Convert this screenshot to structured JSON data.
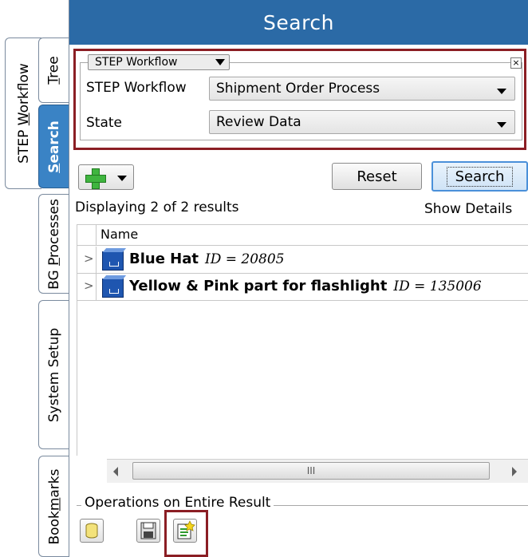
{
  "header": {
    "title": "Search"
  },
  "tabs": {
    "workflow": {
      "label_pre": "STEP ",
      "label_u": "W",
      "label_post": "orkflow"
    },
    "tree": {
      "label_pre": "",
      "label_u": "T",
      "label_post": "ree"
    },
    "search": {
      "label_pre": "",
      "label_u": "S",
      "label_post": "earch"
    },
    "bg": {
      "label_pre": "BG ",
      "label_u": "P",
      "label_post": "rocesses"
    },
    "system": {
      "label": "System Setup"
    },
    "bookmarks": {
      "label_pre": "Book",
      "label_u": "m",
      "label_post": "arks"
    }
  },
  "workflow_box": {
    "group_label": "STEP Workflow",
    "close": "×",
    "fields": [
      {
        "label": "STEP Workflow",
        "value": "Shipment Order Process"
      },
      {
        "label": "State",
        "value": "Review Data"
      }
    ]
  },
  "toolbar": {
    "reset_label": "Reset",
    "search_label": "Search"
  },
  "results": {
    "summary": "Displaying 2 of 2 results",
    "show_details": "Show Details",
    "column_name": "Name",
    "rows": [
      {
        "expander": ">",
        "name": "Blue Hat",
        "id": "ID = 20805"
      },
      {
        "expander": ">",
        "name": "Yellow & Pink part for flashlight",
        "id": "ID = 135006"
      }
    ]
  },
  "scrollbar": {
    "grip": "III"
  },
  "operations": {
    "title": "Operations on Entire Result",
    "buttons": [
      "database-icon",
      "save-icon",
      "export-icon"
    ]
  },
  "colors": {
    "header_bg": "#2b6aa6",
    "highlight_border": "#8b1e24",
    "active_tab": "#3a83c5"
  }
}
